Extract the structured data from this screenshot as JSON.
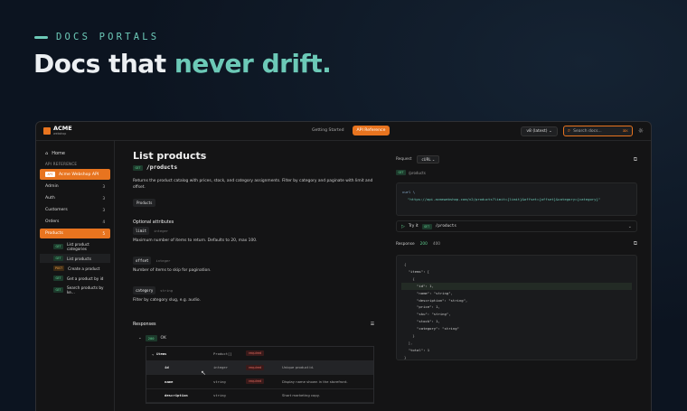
{
  "hero": {
    "eyebrow": "DOCS PORTALS",
    "headline_plain": "Docs that ",
    "headline_accent": "never drift.",
    "accent_color": "#6cc9b7"
  },
  "app": {
    "brand": "ACME",
    "brand_sub": "webshop",
    "brand_color": "#e8741f",
    "tabs": [
      {
        "label": "Getting Started"
      },
      {
        "label": "API Reference"
      }
    ],
    "version": "v8 (latest)",
    "search_placeholder": "Search docs...",
    "search_kbd": "⌘K"
  },
  "sidebar": {
    "home": "Home",
    "section": "API REFERENCE",
    "api": "Acme Webshop API",
    "items": [
      {
        "label": "Admin",
        "count": "3"
      },
      {
        "label": "Auth",
        "count": "3"
      },
      {
        "label": "Customers",
        "count": "3"
      },
      {
        "label": "Orders",
        "count": "4"
      },
      {
        "label": "Products",
        "count": "5"
      }
    ],
    "subitems": [
      {
        "method": "GET",
        "label": "List product categories"
      },
      {
        "method": "GET",
        "label": "List products"
      },
      {
        "method": "POST",
        "label": "Create a product"
      },
      {
        "method": "GET",
        "label": "Get a product by id"
      },
      {
        "method": "GET",
        "label": "Search products by ke..."
      }
    ]
  },
  "main": {
    "title": "List products",
    "method": "GET",
    "path": "/products",
    "description": "Returns the product catalog with prices, stock, and category assignments. Filter by category and paginate with limit and offset.",
    "tag": "Products",
    "optional_title": "Optional attributes",
    "attributes": [
      {
        "name": "limit",
        "type": "integer",
        "desc": "Maximum number of items to return. Defaults to 20, max 100."
      },
      {
        "name": "offset",
        "type": "integer",
        "desc": "Number of items to skip for pagination."
      },
      {
        "name": "category",
        "type": "string",
        "desc": "Filter by category slug, e.g. audio."
      }
    ],
    "responses_title": "Responses",
    "status_code": "200",
    "status_text": "OK",
    "rows": [
      {
        "field": "items",
        "type": "Product[]",
        "req": "required",
        "desc": ""
      },
      {
        "field": "id",
        "type": "integer",
        "req": "required",
        "desc": "Unique product id."
      },
      {
        "field": "name",
        "type": "string",
        "req": "required",
        "desc": "Display name shown in the storefront."
      },
      {
        "field": "description",
        "type": "string",
        "req": "",
        "desc": "Short marketing copy."
      }
    ]
  },
  "right": {
    "request_label": "Request",
    "lang": "cURL",
    "method": "GET",
    "path": "/products",
    "curl_cmd": "curl \\",
    "curl_url": "\"https://api.acmewebshop.com/v2/products?limit={limit}&offset={offset}&category={category}\"",
    "try_label": "Try it",
    "response_label": "Response",
    "codes": [
      "200",
      "400"
    ],
    "json_lines": [
      "{",
      "  \"items\": [",
      "    {",
      "      \"id\": 1,",
      "      \"name\": \"string\",",
      "      \"description\": \"string\",",
      "      \"price\": 1,",
      "      \"sku\": \"string\",",
      "      \"stock\": 1,",
      "      \"category\": \"string\"",
      "    }",
      "  ],",
      "  \"total\": 1",
      "}"
    ]
  }
}
